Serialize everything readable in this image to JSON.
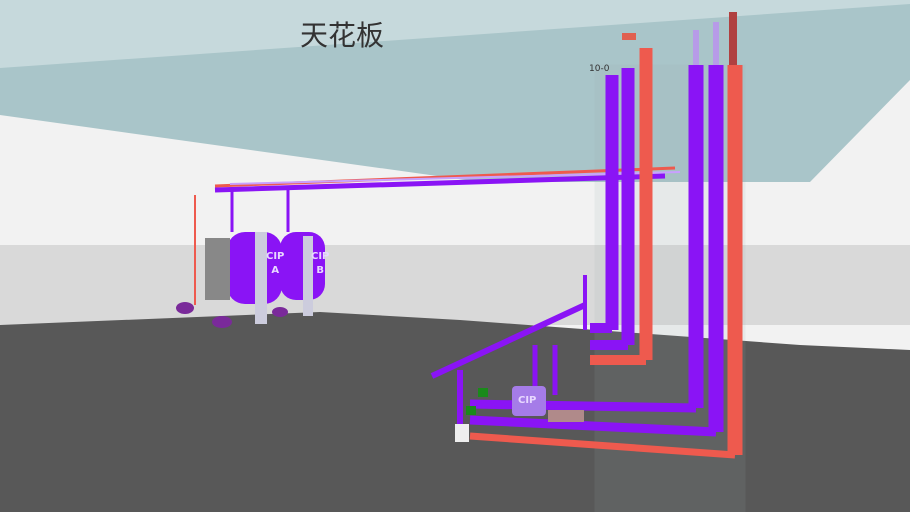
{
  "scene": {
    "ceiling_label": "天花板",
    "level_label": "10-0",
    "tanks": [
      {
        "label": "CIP",
        "sub": "A"
      },
      {
        "label": "CIP",
        "sub": "B"
      }
    ],
    "small_tank_label": "CIP"
  },
  "colors": {
    "purple": "#8a14f5",
    "red": "#ee5a4e",
    "ceiling": "#a8c4c8",
    "floor": "#5a5a5a"
  }
}
